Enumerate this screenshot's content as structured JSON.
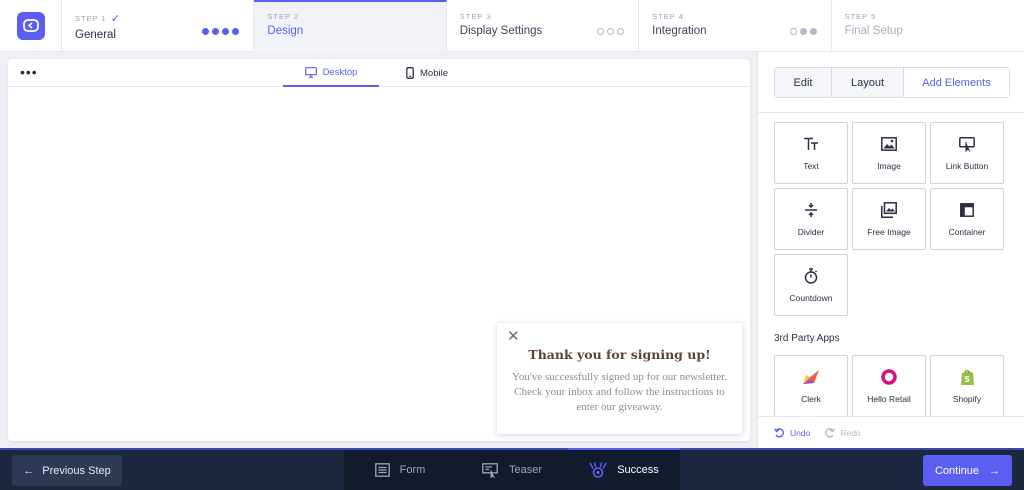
{
  "steps": [
    {
      "num": "STEP 1",
      "title": "General",
      "state": "done"
    },
    {
      "num": "STEP 2",
      "title": "Design",
      "state": "active"
    },
    {
      "num": "STEP 3",
      "title": "Display Settings",
      "state": "future"
    },
    {
      "num": "STEP 4",
      "title": "Integration",
      "state": "future"
    },
    {
      "num": "STEP 5",
      "title": "Final Setup",
      "state": "disabled"
    }
  ],
  "canvas": {
    "more_label": "•••",
    "tabs": {
      "desktop": "Desktop",
      "mobile": "Mobile"
    },
    "active_tab": "Desktop"
  },
  "popup": {
    "close": "✕",
    "title": "Thank you for signing up!",
    "body": "You've successfully signed up for our newsletter. Check your inbox and follow the instructions to enter our giveaway."
  },
  "panel": {
    "tabs": {
      "edit": "Edit",
      "layout": "Layout",
      "add": "Add Elements"
    },
    "active_tab": "Add Elements",
    "elements": [
      {
        "label": "Text",
        "icon": "text-icon"
      },
      {
        "label": "Image",
        "icon": "image-icon"
      },
      {
        "label": "Link Button",
        "icon": "link-button-icon"
      },
      {
        "label": "Divider",
        "icon": "divider-icon"
      },
      {
        "label": "Free Image",
        "icon": "free-image-icon"
      },
      {
        "label": "Container",
        "icon": "container-icon"
      },
      {
        "label": "Countdown",
        "icon": "stopwatch-icon"
      }
    ],
    "third_party_title": "3rd Party Apps",
    "apps": [
      {
        "label": "Clerk",
        "icon": "clerk-logo-icon"
      },
      {
        "label": "Hello Retail",
        "icon": "hello-retail-logo-icon"
      },
      {
        "label": "Shopify",
        "icon": "shopify-logo-icon"
      }
    ],
    "undo": "Undo",
    "redo": "Redo"
  },
  "bottom": {
    "prev": "Previous Step",
    "modes": [
      {
        "label": "Form",
        "icon": "form-icon"
      },
      {
        "label": "Teaser",
        "icon": "teaser-icon"
      },
      {
        "label": "Success",
        "icon": "success-icon"
      }
    ],
    "active_mode": "Success",
    "continue": "Continue"
  },
  "colors": {
    "accent": "#5a5ff2",
    "bottom_bar": "#1e2740"
  }
}
